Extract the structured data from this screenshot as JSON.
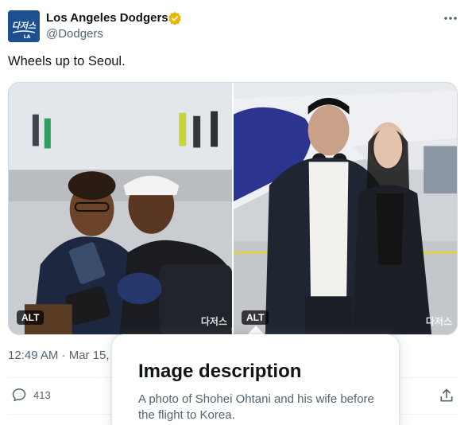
{
  "author": {
    "name": "Los Angeles Dodgers",
    "handle": "@Dodgers",
    "avatar_text": "다저스",
    "verified": true,
    "verified_color": "#e8b500"
  },
  "tweet": {
    "text": "Wheels up to Seoul.",
    "timestamp": "12:49 AM · Mar 15, 2"
  },
  "media": [
    {
      "alt_badge": "ALT",
      "watermark": "다저스",
      "subject": "photo of a smiling couple in dark jackets on an airport tarmac"
    },
    {
      "alt_badge": "ALT",
      "watermark": "다저스",
      "subject": "photo of Shohei Ohtani and his wife in front of a plane"
    }
  ],
  "actions": {
    "reply_count": "413",
    "reply_icon": "reply-icon",
    "share_icon": "share-icon",
    "more_icon": "more-icon"
  },
  "image_description": {
    "title": "Image description",
    "body": "A photo of Shohei Ohtani and his wife before the flight to Korea."
  },
  "colors": {
    "text_primary": "#0f1419",
    "text_secondary": "#536471",
    "dodger_blue": "#1d4f91",
    "border": "#cfd9de"
  }
}
